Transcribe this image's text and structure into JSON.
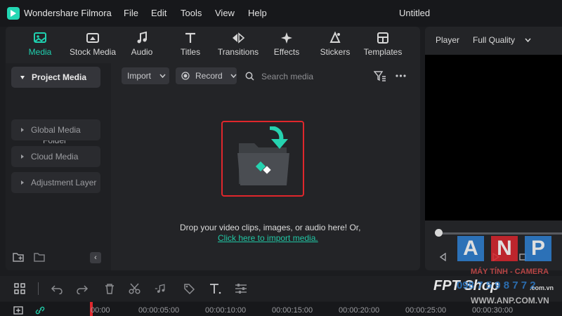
{
  "app": {
    "name": "Wondershare Filmora",
    "document_title": "Untitled"
  },
  "menu": [
    "File",
    "Edit",
    "Tools",
    "View",
    "Help"
  ],
  "tabs": [
    {
      "label": "Media",
      "icon": "media-icon",
      "active": true
    },
    {
      "label": "Stock Media",
      "icon": "stock-media-icon",
      "active": false
    },
    {
      "label": "Audio",
      "icon": "music-note-icon",
      "active": false
    },
    {
      "label": "Titles",
      "icon": "text-t-icon",
      "active": false
    },
    {
      "label": "Transitions",
      "icon": "transitions-icon",
      "active": false
    },
    {
      "label": "Effects",
      "icon": "effects-sparkle-icon",
      "active": false
    },
    {
      "label": "Stickers",
      "icon": "stickers-icon",
      "active": false
    },
    {
      "label": "Templates",
      "icon": "templates-icon",
      "active": false
    }
  ],
  "sidebar": {
    "items": [
      {
        "label": "Project Media",
        "active": true
      },
      {
        "label": "Folder",
        "active": false
      },
      {
        "label": "Global Media",
        "active": false
      },
      {
        "label": "Cloud Media",
        "active": false
      },
      {
        "label": "Adjustment Layer",
        "active": false
      }
    ]
  },
  "media_toolbar": {
    "import_label": "Import",
    "record_label": "Record",
    "search_placeholder": "Search media"
  },
  "dropzone": {
    "text": "Drop your video clips, images, or audio here! Or,",
    "link": "Click here to import media."
  },
  "player": {
    "label": "Player",
    "quality": "Full Quality"
  },
  "timeline": {
    "ticks": [
      "00:00",
      "00:00:05:00",
      "00:00:10:00",
      "00:00:15:00",
      "00:00:20:00",
      "00:00:25:00",
      "00:00:30:00"
    ]
  },
  "watermark": {
    "letters": [
      "A",
      "N",
      "P"
    ],
    "line1": "MÁY TÍNH - CAMERA",
    "brand": "FPT Shop",
    "phone": "098 7 5 9 8 7 7 2",
    "site": "WWW.ANP.COM.VN",
    "shop_url": ".com.vn"
  },
  "colors": {
    "accent": "#1fd1b0",
    "highlight_box": "#e0272c",
    "anp_blue": "#2e7fd1",
    "anp_red": "#d8262d"
  }
}
